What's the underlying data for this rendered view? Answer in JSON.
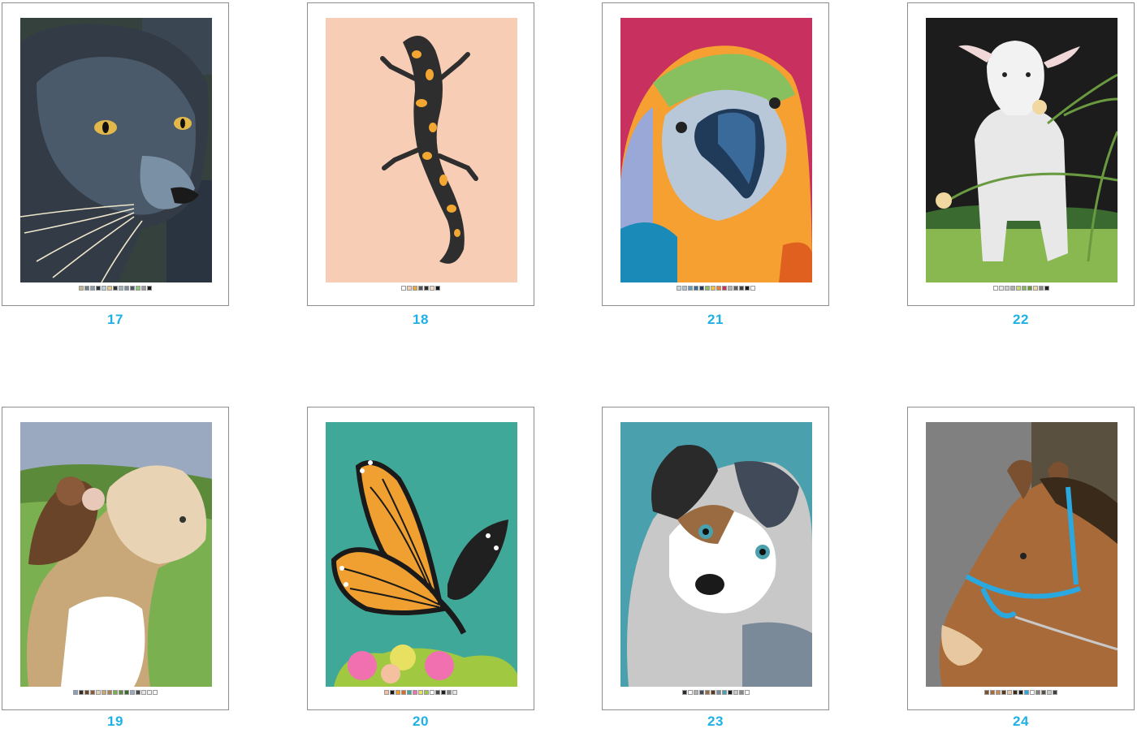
{
  "colors": {
    "page_number": "#1eb1e6",
    "card_border": "#8d8d8d"
  },
  "pages": [
    {
      "number": "17",
      "subject": "panther-icon",
      "swatches": [
        "#c8b48c",
        "#6f7f8d",
        "#8a9aa6",
        "#2d3640",
        "#b8d0dc",
        "#e8c87a",
        "#333333",
        "#9cb3c0",
        "#7a8ea0",
        "#505a66",
        "#86c878",
        "#9a9a9a",
        "#1a1a1a"
      ]
    },
    {
      "number": "18",
      "subject": "salamander-icon",
      "swatches": [
        "#ffffff",
        "#f8cdb6",
        "#f3a733",
        "#555555",
        "#2e2e2e",
        "#f7d8c4",
        "#141414"
      ]
    },
    {
      "number": "21",
      "subject": "parrot-icon",
      "swatches": [
        "#c8d8e0",
        "#a8c4d8",
        "#6a9ab8",
        "#3a6a9a",
        "#203a5a",
        "#88c060",
        "#f5c040",
        "#f08030",
        "#c83060",
        "#b0b0b0",
        "#606060",
        "#404040",
        "#1a1a1a",
        "#ffffff"
      ]
    },
    {
      "number": "22",
      "subject": "lamb-icon",
      "swatches": [
        "#ffffff",
        "#e8e8e8",
        "#d0d0d0",
        "#b0b0b0",
        "#c8d878",
        "#8ab850",
        "#6a9a40",
        "#f0d8a0",
        "#888888",
        "#202020"
      ]
    },
    {
      "number": "19",
      "subject": "lion-cub-monkey-icon",
      "swatches": [
        "#8aa0c0",
        "#3a2a1e",
        "#6a4428",
        "#8a5a3a",
        "#e8d4b4",
        "#c8a878",
        "#b08050",
        "#7ab050",
        "#5a8a3a",
        "#3a6a30",
        "#9aa8c0",
        "#4a4a4a",
        "#e8e8e8",
        "#f0f0f0",
        "#ffffff"
      ]
    },
    {
      "number": "20",
      "subject": "butterfly-icon",
      "swatches": [
        "#f5c0a0",
        "#1a1a1a",
        "#f0a030",
        "#e06a20",
        "#40a898",
        "#f070b0",
        "#e8e060",
        "#a0c840",
        "#ffffff",
        "#4a4a4a",
        "#202020",
        "#888888",
        "#e8e8e8"
      ]
    },
    {
      "number": "23",
      "subject": "puppy-icon",
      "swatches": [
        "#2a2a2a",
        "#ffffff",
        "#b0b0b0",
        "#404a58",
        "#9a6a40",
        "#5a3a22",
        "#7a8a98",
        "#4aa0ac",
        "#1a1a1a",
        "#c8c8c8",
        "#888888",
        "#ffffff"
      ]
    },
    {
      "number": "24",
      "subject": "horse-icon",
      "swatches": [
        "#7a5030",
        "#a86a38",
        "#c88a50",
        "#5a3a20",
        "#e8c8a0",
        "#3a2a1a",
        "#1a1a1a",
        "#2aa8e0",
        "#ffffff",
        "#808080",
        "#5a5040",
        "#c8c8c8",
        "#404040"
      ]
    }
  ]
}
